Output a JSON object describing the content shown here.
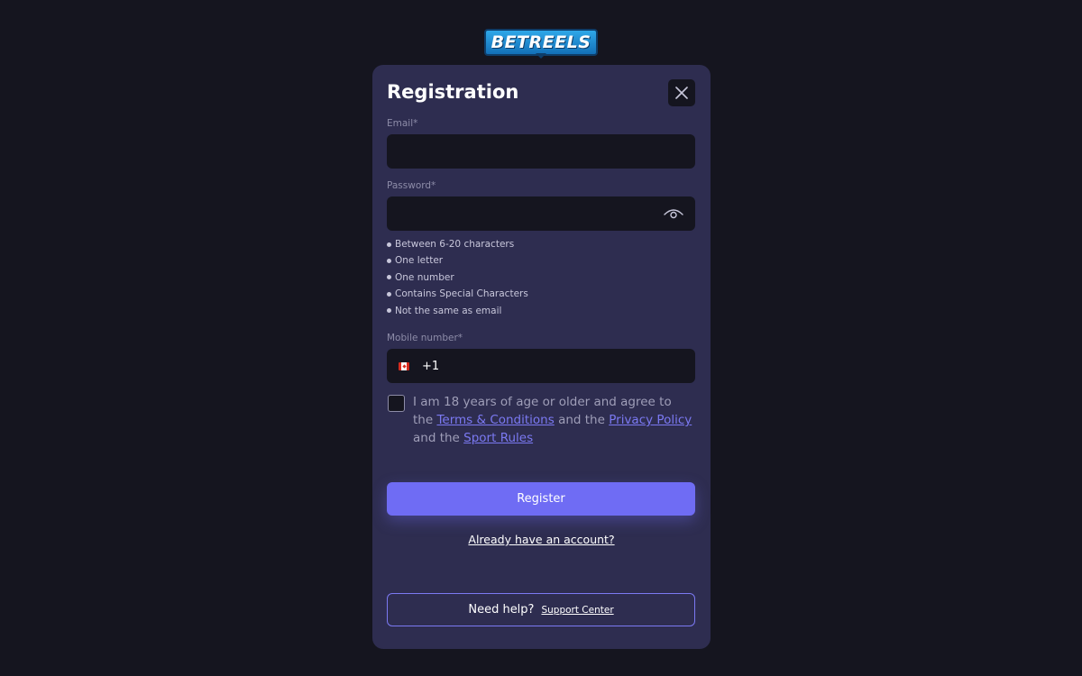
{
  "brand": {
    "logo_text": "BETREELS"
  },
  "modal": {
    "title": "Registration",
    "close_icon": "close-icon"
  },
  "form": {
    "email_label": "Email*",
    "email_value": "",
    "password_label": "Password*",
    "password_value": "",
    "password_toggle_icon": "eye-icon",
    "password_rules": [
      "Between 6-20 characters",
      "One letter",
      "One number",
      "Contains Special Characters",
      "Not the same as email"
    ],
    "mobile_label": "Mobile number*",
    "country_flag_icon": "canada-flag-icon",
    "dial_code": "+1",
    "mobile_value": "",
    "consent": {
      "checked": false,
      "text_1": "I am 18 years of age or older and agree to the",
      "terms_link": "Terms & Conditions",
      "text_2": "and the",
      "privacy_link": "Privacy Policy",
      "text_3": "and the",
      "sport_rules_link": "Sport Rules"
    },
    "register_label": "Register",
    "login_link": "Already have an account?"
  },
  "help": {
    "text": "Need help?",
    "support_link": "Support Center"
  },
  "colors": {
    "background": "#15151f",
    "modal": "#2e2d50",
    "accent": "#6f6cf4",
    "link": "#7b79f2"
  }
}
